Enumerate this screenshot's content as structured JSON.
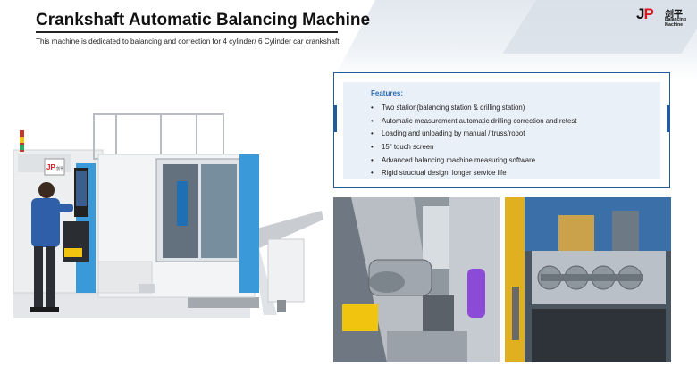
{
  "header": {
    "title": "Crankshaft Automatic Balancing Machine",
    "subtitle": "This machine is dedicated to balancing and correction for 4 cylinder/ 6 Cylinder car crankshaft."
  },
  "logo": {
    "mark_j": "J",
    "mark_p": "P",
    "chinese": "剑平",
    "english": "Balancing Machine",
    "colors": {
      "red": "#d7191f",
      "dark": "#111111"
    }
  },
  "features": {
    "heading": "Features:",
    "items": [
      "Two station(balancing station & drilling station)",
      "Automatic measurement automatic drilling correction and retest",
      "Loading and unloading by manual / truss/robot",
      "15'' touch screen",
      "Advanced balancing machine measuring software",
      "Rigid structual design, longer service life"
    ]
  },
  "machine_panel": {
    "logo_mark": "JP",
    "logo_chinese": "剑平"
  },
  "theme": {
    "accent": "#1f5b9e",
    "features_heading_color": "#2b6db3",
    "panel_bg": "#eaf0f7",
    "machine_blue": "#3a9ad9"
  }
}
